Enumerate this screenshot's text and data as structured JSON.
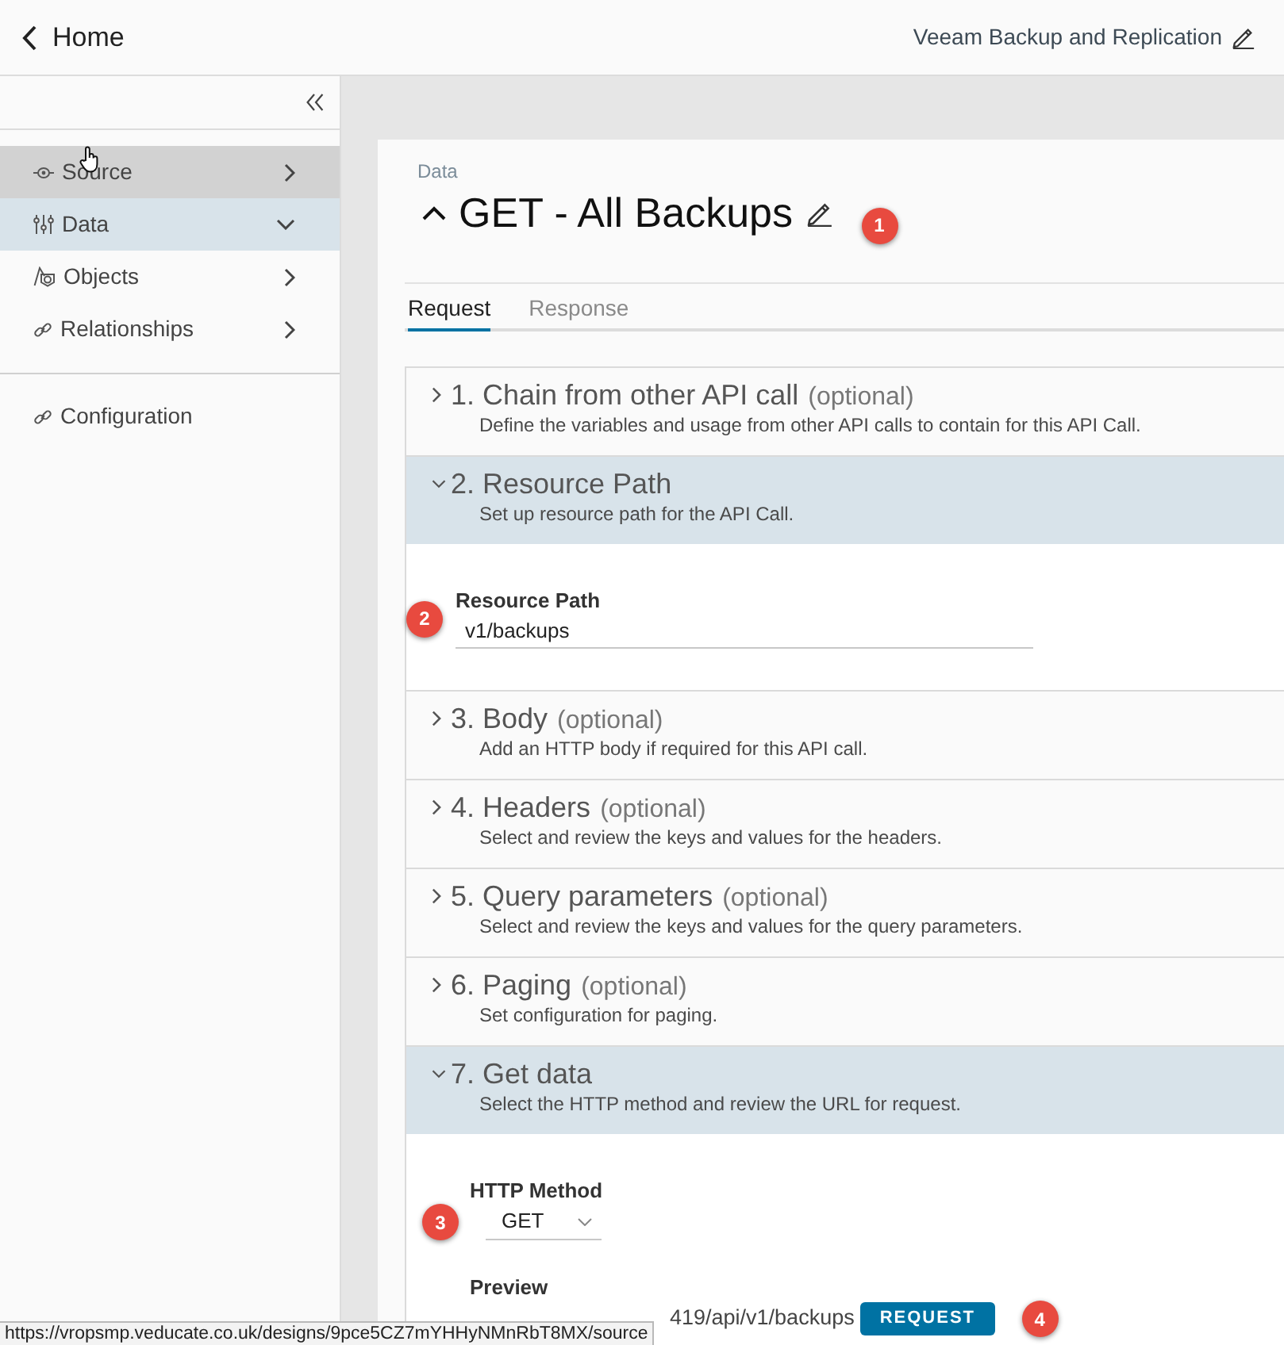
{
  "top_bar": {
    "back_label": "Home",
    "app_name": "Veeam Backup and Replication"
  },
  "sidebar": {
    "items": [
      {
        "label": "Source",
        "hovered": true,
        "selected": false,
        "expanded": false
      },
      {
        "label": "Data",
        "hovered": false,
        "selected": true,
        "expanded": true
      },
      {
        "label": "Objects",
        "hovered": false,
        "selected": false,
        "expanded": false
      },
      {
        "label": "Relationships",
        "hovered": false,
        "selected": false,
        "expanded": false
      }
    ],
    "footer_items": [
      {
        "label": "Configuration"
      }
    ]
  },
  "header": {
    "breadcrumb": "Data",
    "title": "GET - All Backups",
    "expanded": true,
    "callout": "1"
  },
  "tabs": [
    {
      "label": "Request",
      "selected": true
    },
    {
      "label": "Response",
      "selected": false
    }
  ],
  "sections": [
    {
      "title": "1. Chain from other API call",
      "note": "(optional)",
      "description": "Define the variables and usage from other API calls to contain for this API Call.",
      "expanded": false
    },
    {
      "title": "2. Resource Path",
      "description": "Set up resource path for the API Call.",
      "expanded": true,
      "fields": [
        {
          "kind": "text",
          "label": "Resource Path",
          "value": "v1/backups",
          "callout": "2"
        }
      ]
    },
    {
      "title": "3. Body",
      "note": "(optional)",
      "description": "Add an HTTP body if required for this API call.",
      "expanded": false
    },
    {
      "title": "4. Headers",
      "note": "(optional)",
      "description": "Select and review the keys and values for the headers.",
      "expanded": false
    },
    {
      "title": "5. Query parameters",
      "note": "(optional)",
      "description": "Select and review the keys and values for the query parameters.",
      "expanded": false
    },
    {
      "title": "6. Paging",
      "note": "(optional)",
      "description": "Set configuration for paging.",
      "expanded": false
    },
    {
      "title": "7. Get data",
      "description": "Select the HTTP method and review the URL for request.",
      "expanded": true,
      "fields": [
        {
          "kind": "select",
          "label": "HTTP Method",
          "value": "GET",
          "callout": "3"
        },
        {
          "kind": "preview",
          "label": "Preview",
          "value": "419/api/v1/backups",
          "button": "REQUEST",
          "callout": "4"
        }
      ]
    }
  ],
  "status_tooltip": "https://vropsmp.veducate.co.uk/designs/9pce5CZ7mYHHyNMnRbT8MX/source"
}
